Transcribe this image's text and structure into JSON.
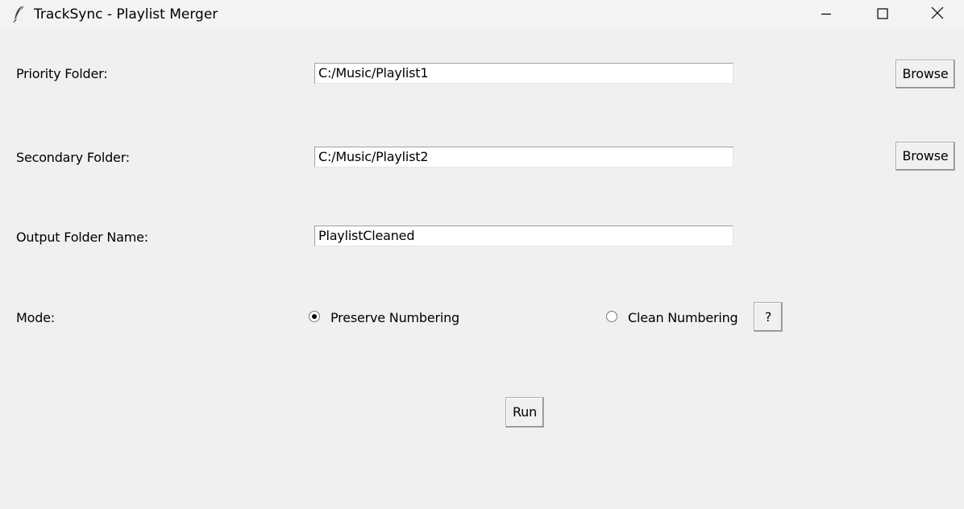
{
  "window": {
    "title": "TrackSync - Playlist Merger",
    "icons": {
      "app": "feather-icon",
      "minimize": "minimize-icon",
      "maximize": "maximize-icon",
      "close": "close-icon"
    }
  },
  "form": {
    "priority": {
      "label": "Priority Folder:",
      "value": "C:/Music/Playlist1",
      "browse_label": "Browse"
    },
    "secondary": {
      "label": "Secondary Folder:",
      "value": "C:/Music/Playlist2",
      "browse_label": "Browse"
    },
    "output": {
      "label": "Output Folder Name:",
      "value": "PlaylistCleaned"
    },
    "mode": {
      "label": "Mode:",
      "options": [
        {
          "label": "Preserve Numbering",
          "selected": true
        },
        {
          "label": "Clean Numbering",
          "selected": false
        }
      ],
      "help_label": "?"
    },
    "run_label": "Run"
  }
}
